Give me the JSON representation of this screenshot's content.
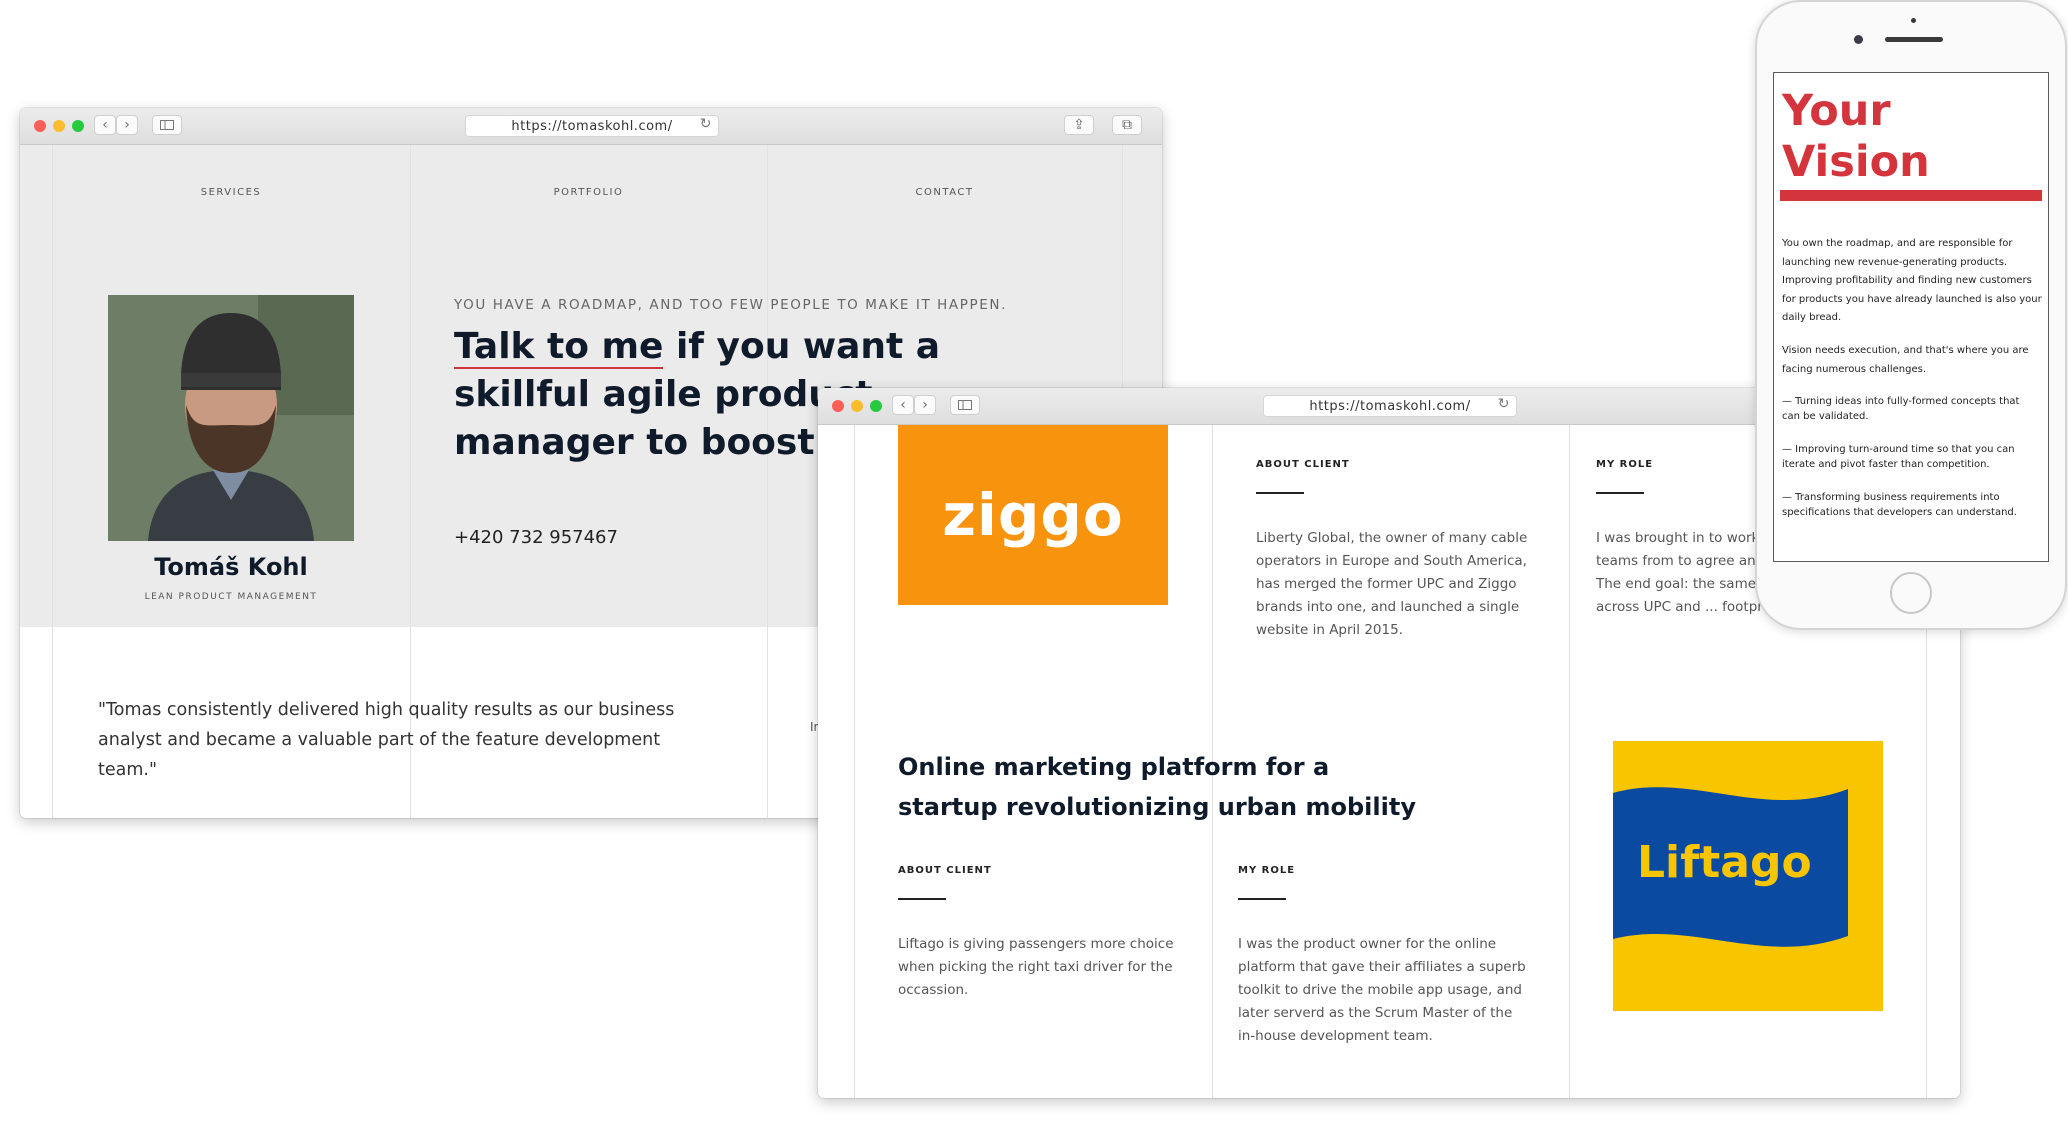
{
  "win1": {
    "url": "https://tomaskohl.com/",
    "nav": [
      "SERVICES",
      "PORTFOLIO",
      "CONTACT"
    ],
    "name": "Tomáš Kohl",
    "role": "LEAN PRODUCT MANAGEMENT",
    "tagline": "YOU HAVE A ROADMAP, AND TOO FEW PEOPLE TO MAKE IT HAPPEN.",
    "headline_highlight": "Talk to me",
    "headline_rest": " if you want a skillful agile product manager to boost your team.",
    "phone": "+420 732 957467",
    "quote": "\"Tomas consistently delivered high quality results as our business analyst and became a valuable part of the feature development team.\"",
    "quote_author_fragment": "In"
  },
  "win2": {
    "url": "https://tomaskohl.com/",
    "ziggo_logo": "ziggo",
    "about_client_label": "ABOUT CLIENT",
    "my_role_label": "MY ROLE",
    "ziggo_about": "Liberty Global, the owner of many cable operators in Europe and South America, has merged the former UPC and Ziggo brands into one, and launched a single website in April 2015.",
    "ziggo_role": "I was brought in to work with marketing teams from to agree and design a u... The end goal: the same experience across UPC and ... footprints.",
    "project2_title": "Online marketing platform for a startup revolutionizing urban mobility",
    "liftago_about": "Liftago is giving passengers more choice when picking the right taxi driver for the occassion.",
    "liftago_role": "I was the product owner for the online platform that gave their affiliates a superb toolkit to drive the mobile app usage, and later serverd as the Scrum Master of the in-house development team.",
    "liftago_logo": "Liftago"
  },
  "phone": {
    "title_line1": "Your",
    "title_line2": "Vision",
    "para1": "You own the roadmap, and are responsible for launching new revenue-generating products. Improving profitability and finding new customers for products you have already launched is also your daily bread.",
    "para2": "Vision needs execution, and that's where you are facing numerous challenges.",
    "bullet1": "— Turning ideas into fully-formed concepts that can be validated.",
    "bullet2": "— Improving turn-around time so that you can iterate and pivot faster than competition.",
    "bullet3": "— Transforming business requirements into specifications that developers can understand."
  },
  "colors": {
    "accent_red": "#d4343b",
    "ziggo_orange": "#f7930c",
    "liftago_yellow": "#f8c500",
    "liftago_blue": "#0a4aa0",
    "heading": "#0f1a2a"
  }
}
